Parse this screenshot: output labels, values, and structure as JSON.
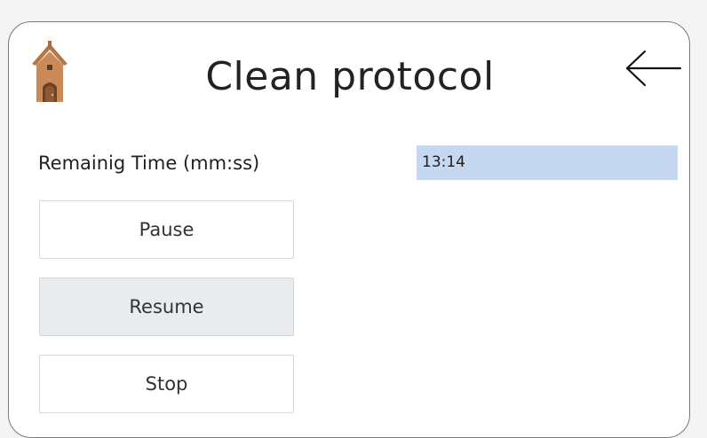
{
  "header": {
    "title": "Clean protocol",
    "home_icon": "home-icon",
    "back_icon": "arrow-left-icon"
  },
  "timer": {
    "label": "Remainig Time (mm:ss)",
    "value": "13:14"
  },
  "controls": {
    "pause_label": "Pause",
    "resume_label": "Resume",
    "stop_label": "Stop"
  },
  "colors": {
    "time_field_bg": "#c5d8f0",
    "disabled_button_bg": "#e9ecef",
    "home_icon_brown": "#b27748"
  }
}
